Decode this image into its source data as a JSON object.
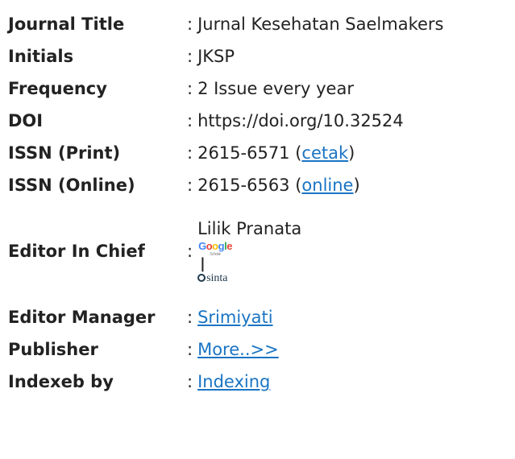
{
  "rows": [
    {
      "label": "Journal Title",
      "sep": ":",
      "value": "Jurnal Kesehatan Saelmakers"
    },
    {
      "label": "Initials",
      "sep": ":",
      "value": "JKSP"
    },
    {
      "label": "Frequency",
      "sep": ":",
      "value": "2 Issue every year"
    },
    {
      "label": "DOI",
      "sep": ":",
      "value": "https://doi.org/10.32524"
    },
    {
      "label": "ISSN (Print)",
      "sep": ":",
      "value": "2615-6571",
      "paren_open": " (",
      "link": "cetak",
      "paren_close": ")"
    },
    {
      "label": "ISSN (Online)",
      "sep": ":",
      "value": "2615-6563",
      "paren_open": " (",
      "link": "online",
      "paren_close": ")"
    },
    {
      "label": "Editor In Chief",
      "sep": ":",
      "name": "Lilik Pranata",
      "google_logo": "Google",
      "google_sub": "Scholar",
      "pipe": "|",
      "sinta_logo": "sinta"
    },
    {
      "label": "Editor Manager",
      "sep": ":",
      "link": "Srimiyati"
    },
    {
      "label": "Publisher",
      "sep": ":",
      "link": "More..>>"
    },
    {
      "label": "Indexeb by",
      "sep": ":",
      "link": "Indexing"
    }
  ],
  "colors": {
    "link": "#1a74c4",
    "text": "#222222",
    "google_blue": "#4285f4",
    "google_red": "#ea4335",
    "google_yellow": "#fbbc05",
    "google_green": "#34a853"
  }
}
